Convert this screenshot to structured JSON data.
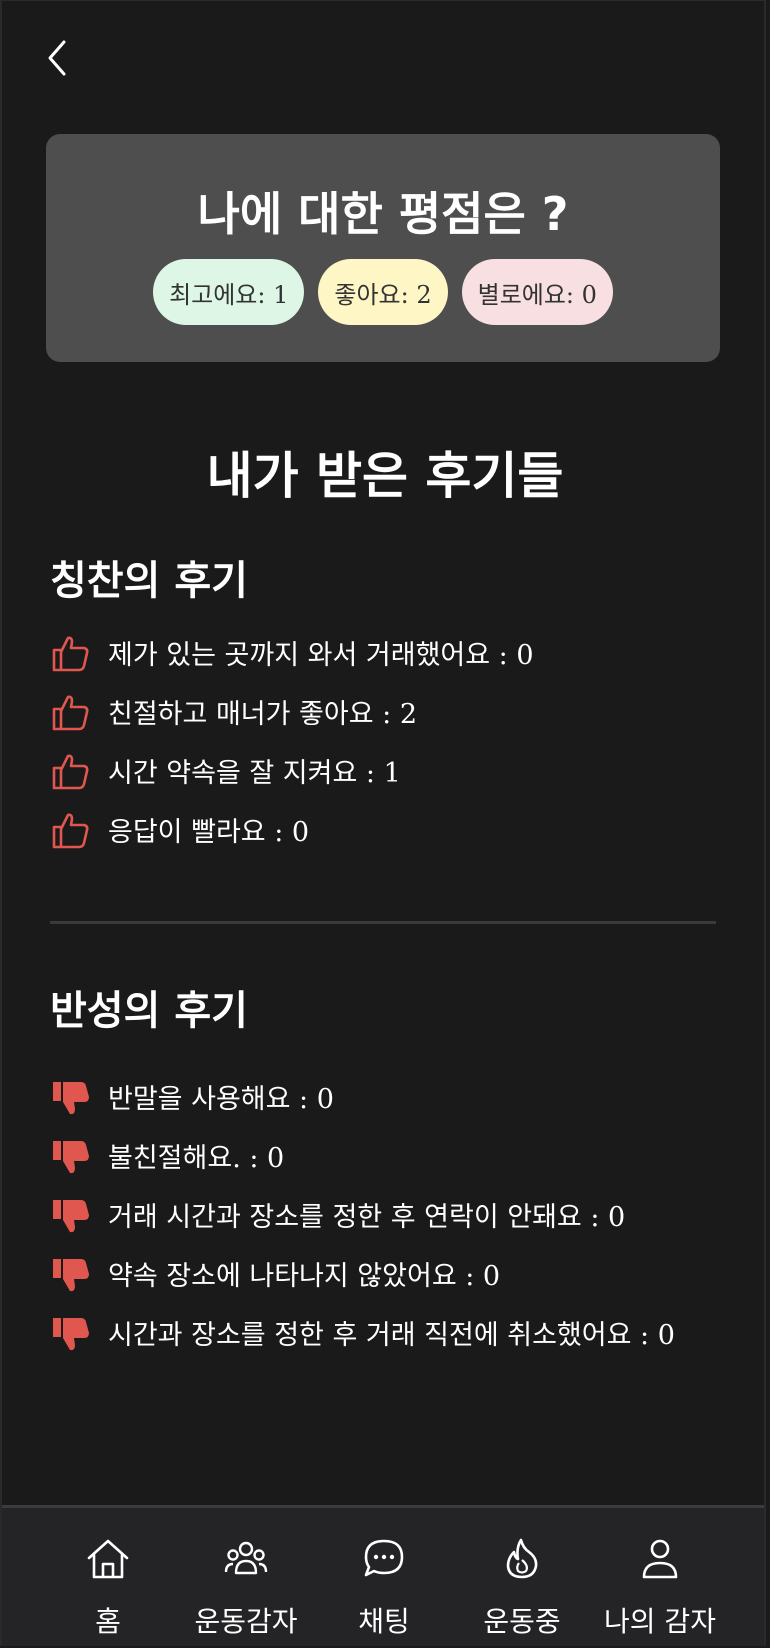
{
  "header": {
    "back_icon": "chevron-left-icon"
  },
  "rating": {
    "title": "나에 대한 평점은 ?",
    "best": "최고에요: 1",
    "good": "좋아요: 2",
    "bad": "별로에요: 0"
  },
  "reviews": {
    "title": "내가 받은 후기들",
    "positive_title": "칭찬의 후기",
    "positive_icon": "thumbs-up-icon",
    "positive": [
      "제가 있는 곳까지 와서 거래했어요 : 0",
      "친절하고 매너가 좋아요 : 2",
      "시간 약속을 잘 지켜요 : 1",
      "응답이 빨라요 : 0"
    ],
    "negative_title": "반성의 후기",
    "negative_icon": "thumbs-down-icon",
    "negative": [
      "반말을 사용해요 : 0",
      "불친절해요. : 0",
      "거래 시간과 장소를 정한 후 연락이 안돼요 : 0",
      "약속 장소에 나타나지 않았어요 : 0",
      "시간과 장소를 정한 후 거래 직전에 취소했어요 : 0"
    ]
  },
  "nav": {
    "home": "홈",
    "friends": "운동감자",
    "chat": "채팅",
    "workout": "운동중",
    "my": "나의 감자"
  },
  "colors": {
    "background": "#1b1a1a",
    "card": "#4e4e4e",
    "accent_red": "#e0574f",
    "pill_best": "#ddf6e5",
    "pill_good": "#fff6c6",
    "pill_bad": "#f8dfe1"
  }
}
